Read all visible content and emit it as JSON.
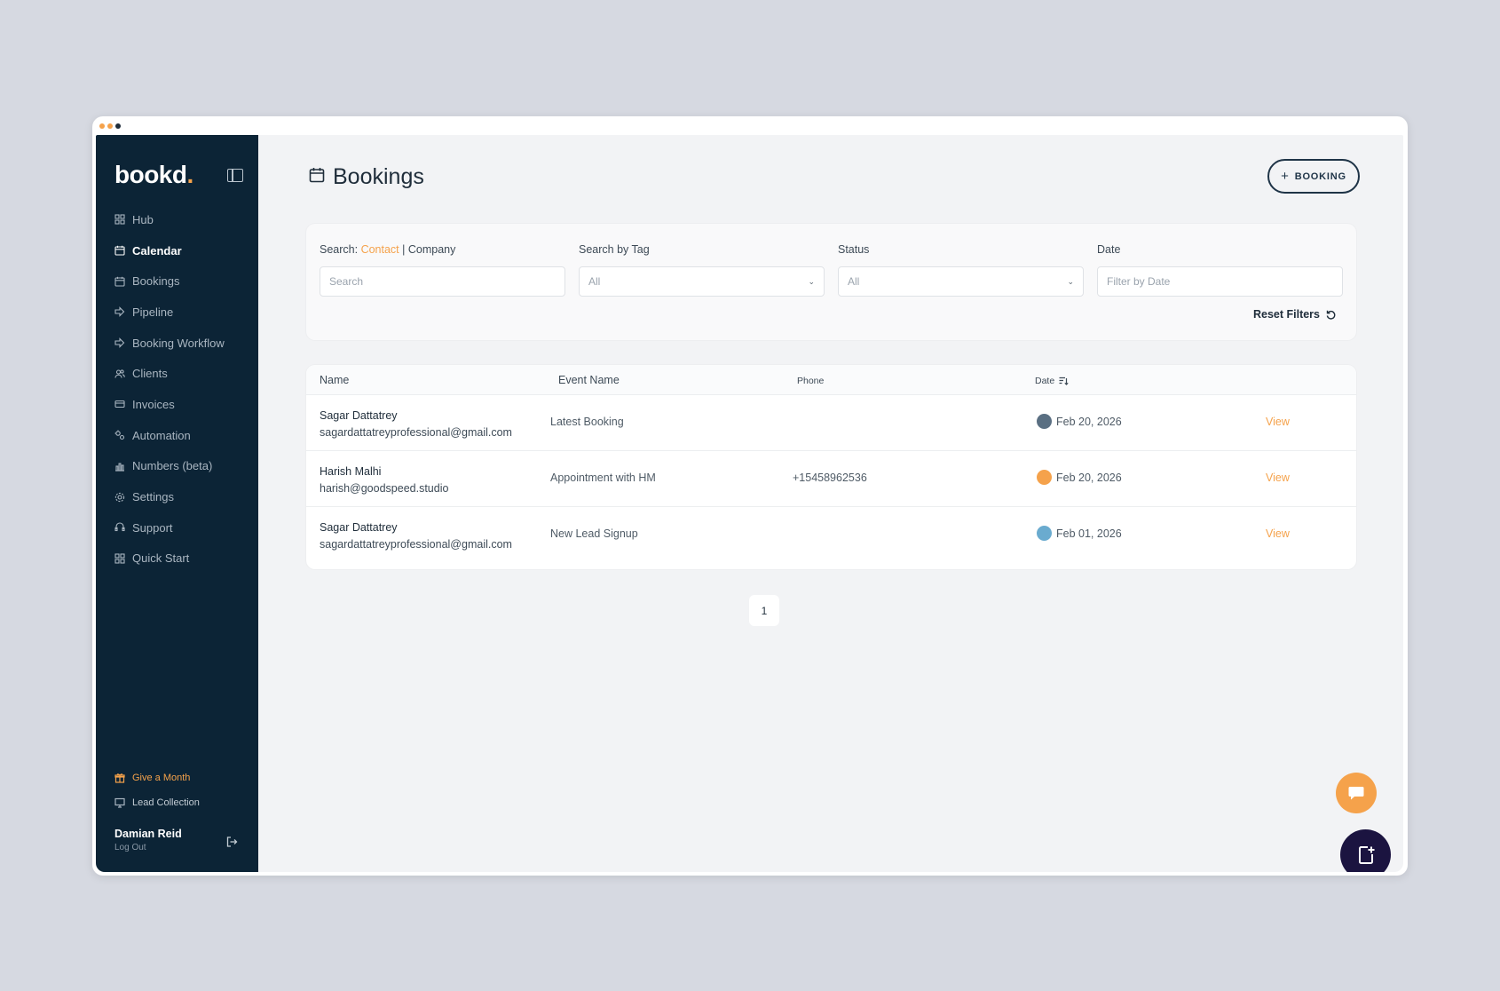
{
  "window": {
    "dot_colors": [
      "#f5a24b",
      "#f5a24b",
      "#1f2d3a"
    ]
  },
  "sidebar": {
    "logo_text": "bookd",
    "logo_dot": ".",
    "items": [
      {
        "label": "Hub",
        "icon": "grid-icon"
      },
      {
        "label": "Calendar",
        "icon": "calendar-icon"
      },
      {
        "label": "Bookings",
        "icon": "calendar-icon"
      },
      {
        "label": "Pipeline",
        "icon": "pipeline-icon"
      },
      {
        "label": "Booking Workflow",
        "icon": "workflow-icon"
      },
      {
        "label": "Clients",
        "icon": "users-icon"
      },
      {
        "label": "Invoices",
        "icon": "card-icon"
      },
      {
        "label": "Automation",
        "icon": "gears-icon"
      },
      {
        "label": "Numbers (beta)",
        "icon": "bar-chart-icon"
      },
      {
        "label": "Settings",
        "icon": "gear-icon"
      },
      {
        "label": "Support",
        "icon": "support-icon"
      },
      {
        "label": "Quick Start",
        "icon": "grid-icon"
      }
    ],
    "active_item": "Calendar",
    "bottom": {
      "gift_label": "Give a Month",
      "lead_label": "Lead Collection"
    },
    "user": {
      "name": "Damian Reid",
      "logout_label": "Log Out"
    }
  },
  "header": {
    "title": "Bookings",
    "add_button_label": "BOOKING"
  },
  "filters": {
    "search_label_prefix": "Search:",
    "search_contact": "Contact",
    "search_separator": "|",
    "search_company": "Company",
    "search_placeholder": "Search",
    "tag_label": "Search by Tag",
    "tag_value": "All",
    "status_label": "Status",
    "status_value": "All",
    "date_label": "Date",
    "date_placeholder": "Filter by Date",
    "reset_label": "Reset Filters"
  },
  "table": {
    "columns": {
      "name": "Name",
      "event": "Event Name",
      "phone": "Phone",
      "date": "Date"
    },
    "rows": [
      {
        "name": "Sagar Dattatrey",
        "email": "sagardattatreyprofessional@gmail.com",
        "event": "Latest Booking",
        "phone": "",
        "date": "Feb 20, 2026",
        "status_color": "#5a6f82",
        "action": "View"
      },
      {
        "name": "Harish Malhi",
        "email": "harish@goodspeed.studio",
        "event": "Appointment with HM",
        "phone": "+15458962536",
        "date": "Feb 20, 2026",
        "status_color": "#f5a24b",
        "action": "View"
      },
      {
        "name": "Sagar Dattatrey",
        "email": "sagardattatreyprofessional@gmail.com",
        "event": "New Lead Signup",
        "phone": "",
        "date": "Feb 01, 2026",
        "status_color": "#6aabcf",
        "action": "View"
      }
    ]
  },
  "pagination": {
    "current_page": "1"
  },
  "colors": {
    "accent": "#f5a24b",
    "sidebar_bg": "#0c2436",
    "fab_bg": "#1b1440"
  }
}
